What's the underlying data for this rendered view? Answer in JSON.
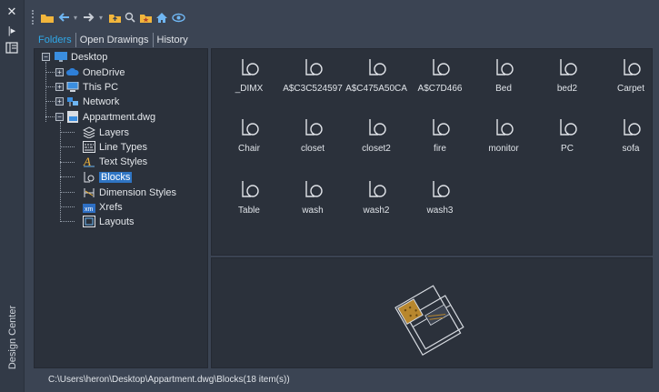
{
  "palette_title": "Design Center",
  "tabs": [
    {
      "label": "Folders",
      "active": true
    },
    {
      "label": "Open Drawings",
      "active": false
    },
    {
      "label": "History",
      "active": false
    }
  ],
  "toolbar_icons": [
    "load-icon",
    "back-icon",
    "forward-icon",
    "up-folder-icon",
    "search-icon",
    "favorites-icon",
    "home-icon",
    "tree-view-toggle-icon"
  ],
  "tree": {
    "desktop": "Desktop",
    "onedrive": "OneDrive",
    "this_pc": "This PC",
    "network": "Network",
    "drawing": "Appartment.dwg",
    "children": [
      "Layers",
      "Line Types",
      "Text Styles",
      "Blocks",
      "Dimension Styles",
      "Xrefs",
      "Layouts"
    ],
    "selected": "Blocks"
  },
  "blocks": [
    "_DIMX",
    "A$C3C524597",
    "A$C475A50CA",
    "A$C7D466",
    "Bed",
    "bed2",
    "Carpet",
    "Chair",
    "closet",
    "closet2",
    "fire",
    "monitor",
    "PC",
    "sofa",
    "Table",
    "wash",
    "wash2",
    "wash3"
  ],
  "status_path": "C:\\Users\\heron\\Desktop\\Appartment.dwg\\Blocks(18 item(s))",
  "colors": {
    "accent": "#2fa8e8",
    "selection": "#2f75c4",
    "panel": "#2b313b",
    "chrome": "#3b4453"
  }
}
